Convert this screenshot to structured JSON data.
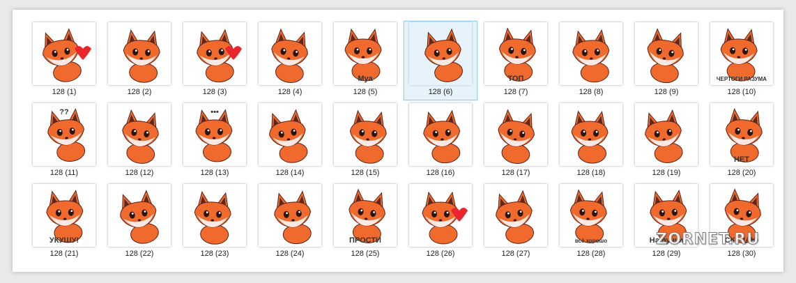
{
  "window": {
    "selected_index": 5
  },
  "files": [
    {
      "name": "128 (1)",
      "icon": "fox-with-heart-sticker-icon"
    },
    {
      "name": "128 (2)",
      "icon": "fox-blushing-sticker-icon"
    },
    {
      "name": "128 (3)",
      "icon": "fox-hearts-sticker-icon"
    },
    {
      "name": "128 (4)",
      "icon": "fox-happy-sticker-icon"
    },
    {
      "name": "128 (5)",
      "icon": "fox-mua-sticker-icon",
      "caption": "Муа"
    },
    {
      "name": "128 (6)",
      "icon": "fox-surprised-sticker-icon"
    },
    {
      "name": "128 (7)",
      "icon": "fox-sign-sticker-icon",
      "caption": "ТОП"
    },
    {
      "name": "128 (8)",
      "icon": "fox-shocked-sticker-icon"
    },
    {
      "name": "128 (9)",
      "icon": "fox-thinking-sticker-icon"
    },
    {
      "name": "128 (10)",
      "icon": "fox-detective-sticker-icon",
      "caption": "ЧЕРТОГИ РАЗУМА"
    },
    {
      "name": "128 (11)",
      "icon": "fox-confused-sticker-icon",
      "caption": "??"
    },
    {
      "name": "128 (12)",
      "icon": "fox-smug-sticker-icon"
    },
    {
      "name": "128 (13)",
      "icon": "fox-ellipsis-sticker-icon",
      "caption": "•••"
    },
    {
      "name": "128 (14)",
      "icon": "fox-sleepy-sticker-icon"
    },
    {
      "name": "128 (15)",
      "icon": "fox-proud-sticker-icon"
    },
    {
      "name": "128 (16)",
      "icon": "fox-shrug-sticker-icon"
    },
    {
      "name": "128 (17)",
      "icon": "fox-facepalm-sticker-icon"
    },
    {
      "name": "128 (18)",
      "icon": "fox-bored-sticker-icon"
    },
    {
      "name": "128 (19)",
      "icon": "fox-grumpy-sticker-icon"
    },
    {
      "name": "128 (20)",
      "icon": "fox-no-sticker-icon",
      "caption": "НЕТ"
    },
    {
      "name": "128 (21)",
      "icon": "fox-bite-sticker-icon",
      "caption": "УКУШУ!"
    },
    {
      "name": "128 (22)",
      "icon": "fox-hiding-sticker-icon"
    },
    {
      "name": "128 (23)",
      "icon": "fox-pillow-sticker-icon"
    },
    {
      "name": "128 (24)",
      "icon": "fox-crying-sticker-icon"
    },
    {
      "name": "128 (25)",
      "icon": "fox-sorry-sticker-icon",
      "caption": "ПРОСТИ"
    },
    {
      "name": "128 (26)",
      "icon": "fox-heartbroken-sticker-icon"
    },
    {
      "name": "128 (27)",
      "icon": "fox-lying-sticker-icon"
    },
    {
      "name": "128 (28)",
      "icon": "fox-all-good-sticker-icon",
      "caption": "всё хорошо"
    },
    {
      "name": "128 (29)",
      "icon": "fox-hug-sticker-icon",
      "caption": "На ручки"
    },
    {
      "name": "128 (30)",
      "icon": "fox-miss-you-sticker-icon",
      "caption": "СКУЧАЮ"
    }
  ],
  "watermark": "ZORNET.RU",
  "colors": {
    "fur": "#ef6a2c",
    "fur_dark": "#d24f17",
    "cream": "#fbe8e2",
    "ear_inner": "#5a2a22",
    "outline": "#5a2218",
    "selection_bg": "#e6f3fb",
    "selection_border": "#99d1f3",
    "heart": "#e8262b"
  }
}
